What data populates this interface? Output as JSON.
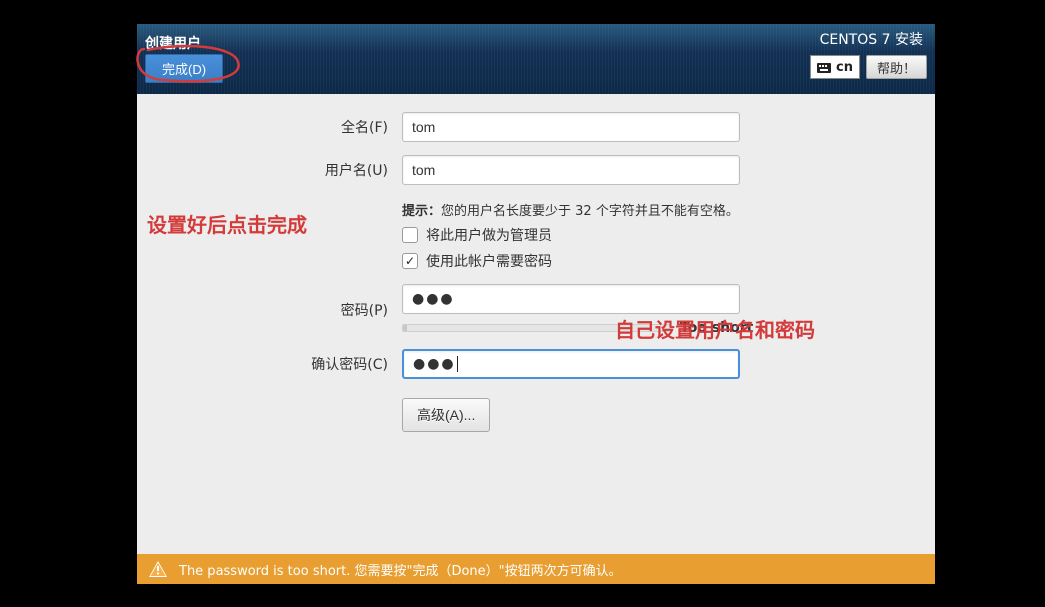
{
  "header": {
    "title": "创建用户",
    "done_button": "完成(D)",
    "installer_title": "CENTOS 7 安装",
    "lang_code": "cn",
    "help_button": "帮助！"
  },
  "form": {
    "fullname_label": "全名(F)",
    "fullname_value": "tom",
    "username_label": "用户名(U)",
    "username_value": "tom",
    "username_hint_bold": "提示：",
    "username_hint": "您的用户名长度要少于 32 个字符并且不能有空格。",
    "make_admin_label": "将此用户做为管理员",
    "require_password_label": "使用此帐户需要密码",
    "password_label": "密码(P)",
    "password_value": "●●●",
    "strength_text": "Too short",
    "confirm_label": "确认密码(C)",
    "confirm_value": "●●●",
    "advanced_button": "高级(A)..."
  },
  "annotations": {
    "click_done": "设置好后点击完成",
    "set_self": "自己设置用户名和密码"
  },
  "warning": {
    "text": "The password is too short. 您需要按\"完成（Done）\"按钮两次方可确认。"
  }
}
